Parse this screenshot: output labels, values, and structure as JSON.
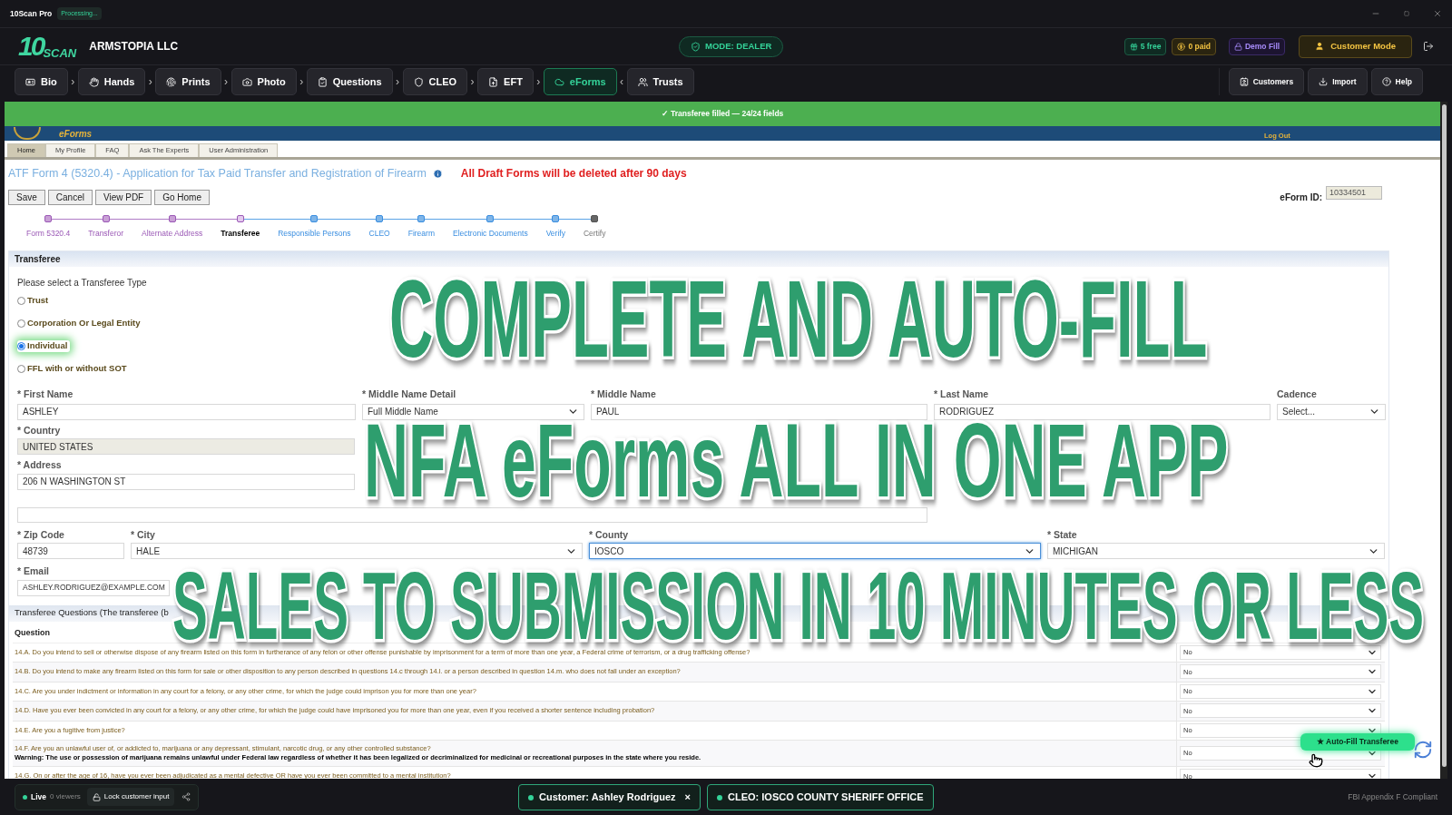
{
  "title_bar": {
    "app": "10Scan Pro",
    "status": "Processing..."
  },
  "header": {
    "logo": {
      "digits": "10",
      "word": "SCAN"
    },
    "company": "ARMSTOPIA LLC",
    "mode": "MODE: DEALER",
    "badges": [
      {
        "label": "5 free",
        "kind": "free"
      },
      {
        "label": "0 paid",
        "kind": "paid"
      },
      {
        "label": "Demo Fill",
        "kind": "demo"
      }
    ],
    "customer_mode": "Customer Mode"
  },
  "nav": {
    "steps": [
      {
        "label": "Bio",
        "selected": false,
        "separator": "›"
      },
      {
        "label": "Hands",
        "selected": false,
        "separator": "›"
      },
      {
        "label": "Prints",
        "selected": false,
        "separator": "›"
      },
      {
        "label": "Photo",
        "selected": false,
        "separator": "›"
      },
      {
        "label": "Questions",
        "selected": false,
        "separator": "›"
      },
      {
        "label": "CLEO",
        "selected": false,
        "separator": "›"
      },
      {
        "label": "EFT",
        "selected": false,
        "separator": "›"
      },
      {
        "label": "eForms",
        "selected": true,
        "separator": "‹"
      },
      {
        "label": "Trusts",
        "selected": false
      }
    ],
    "actions": [
      "Customers",
      "Import",
      "Help"
    ]
  },
  "banner": "✓ Transferee filled — 24/24 fields",
  "eforms_header": {
    "brand": "eForms",
    "logout": "Log Out"
  },
  "site_tabs": [
    {
      "label": "Home",
      "selected": true
    },
    {
      "label": "My Profile",
      "selected": false
    },
    {
      "label": "FAQ",
      "selected": false
    },
    {
      "label": "Ask The Experts",
      "selected": false
    },
    {
      "label": "User Administration",
      "selected": false
    }
  ],
  "form": {
    "title": "ATF Form 4 (5320.4) - Application for Tax Paid Transfer and Registration of Firearm",
    "warning": "All Draft Forms will be deleted after 90 days",
    "buttons": [
      "Save",
      "Cancel",
      "View PDF",
      "Go Home"
    ],
    "eform_id_label": "eForm ID:",
    "eform_id": "10334501"
  },
  "stepper": [
    {
      "label": "Form 5320.4",
      "kind": "done"
    },
    {
      "label": "Transferor",
      "kind": "done"
    },
    {
      "label": "Alternate Address",
      "kind": "done"
    },
    {
      "label": "Transferee",
      "kind": "current"
    },
    {
      "label": "Responsible Persons",
      "kind": "todo"
    },
    {
      "label": "CLEO",
      "kind": "todo"
    },
    {
      "label": "Firearm",
      "kind": "todo"
    },
    {
      "label": "Electronic Documents",
      "kind": "todo"
    },
    {
      "label": "Verify",
      "kind": "todo"
    },
    {
      "label": "Certify",
      "kind": "locked"
    }
  ],
  "transferee": {
    "heading": "Transferee",
    "prompt": "Please select a Transferee Type",
    "types": [
      {
        "label": "Trust",
        "selected": false
      },
      {
        "label": "Corporation Or Legal Entity",
        "selected": false
      },
      {
        "label": "Individual",
        "selected": true
      },
      {
        "label": "FFL with or without SOT",
        "selected": false
      }
    ],
    "name_row": [
      {
        "label": "* First Name",
        "value": "ASHLEY",
        "kind": "text"
      },
      {
        "label": "* Middle Name Detail",
        "value": "Full Middle Name",
        "kind": "select"
      },
      {
        "label": "* Middle Name",
        "value": "PAUL",
        "kind": "text"
      },
      {
        "label": "* Last Name",
        "value": "RODRIGUEZ",
        "kind": "text"
      },
      {
        "label": "Cadence",
        "placeholder": "Select...",
        "kind": "select"
      }
    ],
    "country": {
      "label": "* Country",
      "value": "UNITED STATES"
    },
    "address": {
      "label": "* Address",
      "value": "206 N WASHINGTON ST"
    },
    "place_row": [
      {
        "label": "* Zip Code",
        "value": "48739",
        "kind": "text",
        "focused": false
      },
      {
        "label": "* City",
        "value": "HALE",
        "kind": "select",
        "focused": false
      },
      {
        "label": "* County",
        "value": "IOSCO",
        "kind": "select",
        "focused": true
      },
      {
        "label": "* State",
        "value": "MICHIGAN",
        "kind": "select",
        "focused": false
      }
    ],
    "email": {
      "label": "* Email",
      "value": "ASHLEY.RODRIGUEZ@EXAMPLE.COM"
    }
  },
  "questions": {
    "heading": "Transferee Questions (The transferee (b",
    "column": "Question",
    "rows": [
      {
        "text": "14.A. Do you intend to sell or otherwise dispose of any firearm listed on this form in furtherance of any felon or other offense punishable by imprisonment for a term of more than one year, a Federal crime of terrorism, or a drug trafficking offense?",
        "answer": "No"
      },
      {
        "text": "14.B. Do you intend to make any firearm listed on this form for sale or other disposition to any person described in questions 14.c through 14.l. or a person described in question 14.m. who does not fall under an exception?",
        "answer": "No"
      },
      {
        "text": "14.C. Are you under indictment or information in any court for a felony, or any other crime, for which the judge could imprison you for more than one year?",
        "answer": "No"
      },
      {
        "text": "14.D. Have you ever been convicted in any court for a felony, or any other crime, for which the judge could have imprisoned you for more than one year, even if you received a shorter sentence including probation?",
        "answer": "No"
      },
      {
        "text": "14.E. Are you a fugitive from justice?",
        "answer": "No"
      },
      {
        "text": "14.F. Are you an unlawful user of, or addicted to, marijuana or any depressant, stimulant, narcotic drug, or any other controlled substance?",
        "warning": "Warning: The use or possession of marijuana remains unlawful under Federal law regardless of whether it has been legalized or decriminalized for medicinal or recreational purposes in the state where you reside.",
        "answer": "No"
      },
      {
        "text": "14.G. On or after the age of 16, have you ever been adjudicated as a mental defective OR have you ever been committed to a mental institution?",
        "answer": "No"
      }
    ]
  },
  "autofill": "★ Auto-Fill Transferee",
  "overlay": [
    "COMPLETE AND AUTO-FILL",
    "NFA eForms ALL IN ONE APP",
    "SALES TO SUBMISSION IN 10 MINUTES OR LESS"
  ],
  "footer": {
    "live": "Live",
    "viewers": "0 viewers",
    "lock": "Lock customer input",
    "customer": "Customer: Ashley Rodriguez",
    "close": "×",
    "cleo": "CLEO: IOSCO COUNTY SHERIFF OFFICE",
    "compliance": "FBI Appendix F Compliant"
  }
}
